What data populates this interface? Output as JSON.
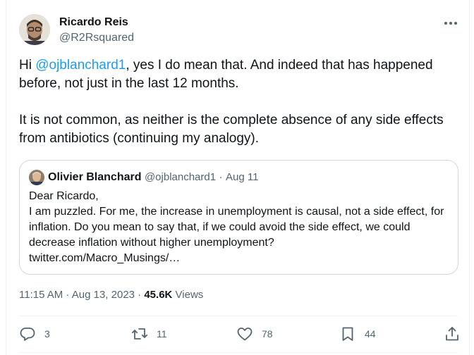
{
  "author": {
    "name": "Ricardo Reis",
    "handle": "@R2Rsquared"
  },
  "tweet": {
    "greeting": "Hi ",
    "mention": "@ojblanchard1",
    "line1_rest": ", yes I do mean that. And indeed that has happened before, not just in the last 12 months.",
    "paragraph2": "It is not common, as neither is the complete absence of any side effects from antibiotics (continuing my analogy)."
  },
  "quote": {
    "name": "Olivier Blanchard",
    "handle": "@ojblanchard1",
    "separator": "·",
    "date": "Aug 11",
    "text": "Dear Ricardo,\nI am puzzled.  For me, the increase in unemployment is causal, not a side effect, for inflation.  Do you mean to say that, if we could avoid the side effect, we could decrease inflation without higher unemployment?\ntwitter.com/Macro_Musings/…"
  },
  "meta": {
    "timestamp": "11:15 AM · Aug 13, 2023 · ",
    "views_count": "45.6K",
    "views_label": " Views"
  },
  "actions": {
    "replies": "3",
    "retweets": "11",
    "likes": "78",
    "bookmarks": "44"
  },
  "icons": {
    "more": "more-icon",
    "reply": "reply-icon",
    "retweet": "retweet-icon",
    "like": "like-icon",
    "bookmark": "bookmark-icon",
    "share": "share-icon"
  },
  "colors": {
    "link": "#1d9bf0",
    "secondary_text": "#536471",
    "border": "#cfd9de"
  }
}
